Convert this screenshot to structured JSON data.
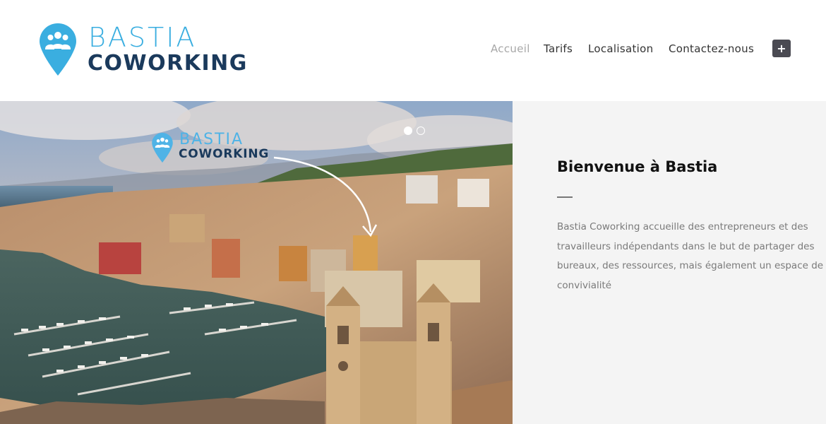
{
  "brand": {
    "line1": "BASTIA",
    "line2": "COWORKING",
    "pin_color": "#3aaee0",
    "dark_color": "#1b3a5c",
    "pin_icon": "people-location-pin-icon"
  },
  "nav": {
    "items": [
      {
        "label": "Accueil",
        "active": true
      },
      {
        "label": "Tarifs",
        "active": false
      },
      {
        "label": "Localisation",
        "active": false
      },
      {
        "label": "Contactez-nous",
        "active": false
      }
    ],
    "plus_label": "+"
  },
  "hero": {
    "overlay_line1": "BASTIA",
    "overlay_line2": "COWORKING",
    "slides": [
      {
        "active": true
      },
      {
        "active": false
      }
    ]
  },
  "panel": {
    "title": "Bienvenue à Bastia",
    "body": "Bastia Coworking accueille des entrepreneurs et des travailleurs indépendants dans le but de partager des bureaux, des ressources, mais également un espace de convivialité"
  }
}
